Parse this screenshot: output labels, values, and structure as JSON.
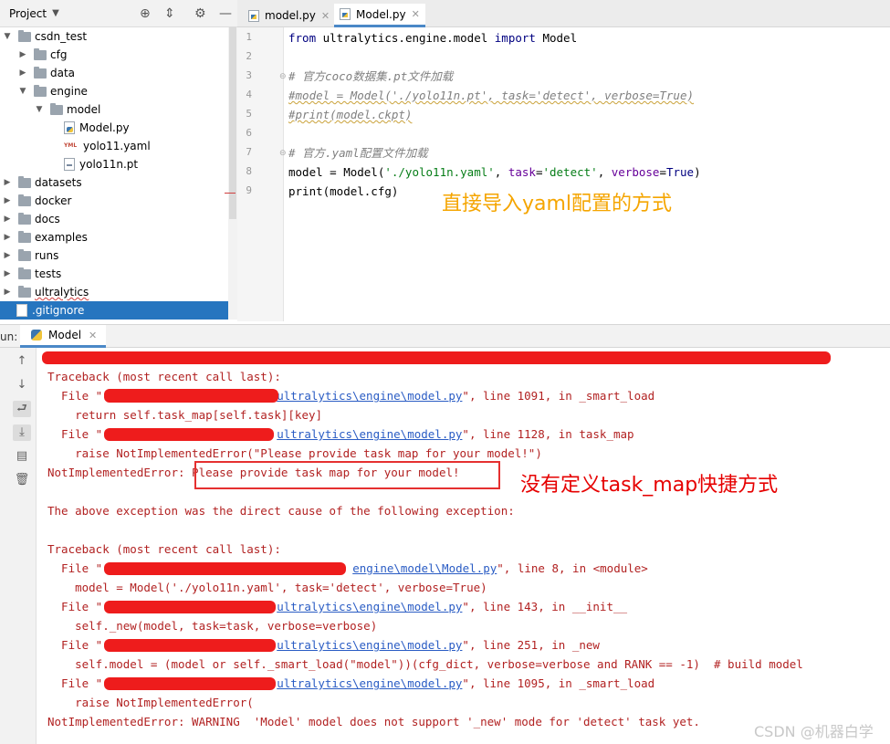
{
  "project_panel": {
    "title": "Project",
    "tree": [
      {
        "label": "csdn_test",
        "type": "folder",
        "depth": 0,
        "expanded": true
      },
      {
        "label": "cfg",
        "type": "folder",
        "depth": 1,
        "expanded": false
      },
      {
        "label": "data",
        "type": "folder",
        "depth": 1,
        "expanded": false
      },
      {
        "label": "engine",
        "type": "folder",
        "depth": 1,
        "expanded": true
      },
      {
        "label": "model",
        "type": "folder",
        "depth": 2,
        "expanded": true
      },
      {
        "label": "Model.py",
        "type": "py",
        "depth": 3
      },
      {
        "label": "yolo11.yaml",
        "type": "yaml",
        "depth": 3
      },
      {
        "label": "yolo11n.pt",
        "type": "pt",
        "depth": 3
      },
      {
        "label": "datasets",
        "type": "folder",
        "depth": 0,
        "expanded": false
      },
      {
        "label": "docker",
        "type": "folder",
        "depth": 0,
        "expanded": false
      },
      {
        "label": "docs",
        "type": "folder",
        "depth": 0,
        "expanded": false
      },
      {
        "label": "examples",
        "type": "folder",
        "depth": 0,
        "expanded": false
      },
      {
        "label": "runs",
        "type": "folder",
        "depth": 0,
        "expanded": false
      },
      {
        "label": "tests",
        "type": "folder",
        "depth": 0,
        "expanded": false
      },
      {
        "label": "ultralytics",
        "type": "folder",
        "depth": 0,
        "expanded": false
      },
      {
        "label": ".gitignore",
        "type": "git",
        "depth": 0,
        "selected": true
      }
    ]
  },
  "editor": {
    "tabs": [
      {
        "label": "model.py",
        "active": false
      },
      {
        "label": "Model.py",
        "active": true
      }
    ],
    "line_numbers": [
      "1",
      "2",
      "3",
      "4",
      "5",
      "6",
      "7",
      "8",
      "9"
    ],
    "code": {
      "l1_kw1": "from",
      "l1_mod": " ultralytics.engine.model ",
      "l1_kw2": "import",
      "l1_name": " Model",
      "l3": "# 官方coco数据集.pt文件加载",
      "l4": "#model = Model('./yolo11n.pt', task='detect', verbose=True)",
      "l5": "#print(model.ckpt)",
      "l7": "# 官方.yaml配置文件加载",
      "l8_a": "model = Model(",
      "l8_s1": "'./yolo11n.yaml'",
      "l8_b": ", ",
      "l8_k1": "task",
      "l8_c": "=",
      "l8_s2": "'detect'",
      "l8_d": ", ",
      "l8_k2": "verbose",
      "l8_e": "=",
      "l8_v": "True",
      "l8_f": ")",
      "l9": "print(model.cfg)"
    },
    "annotation": "直接导入yaml配置的方式"
  },
  "run_panel": {
    "label": "un:",
    "tab": "Model",
    "console": {
      "l2": "Traceback (most recent call last):",
      "l3_a": "  File \"",
      "l3_link": "ultralytics\\engine\\model.py",
      "l3_b": "\", line 1091, in _smart_load",
      "l4": "    return self.task_map[self.task][key]",
      "l5_a": "  File \"",
      "l5_link": "ultralytics\\engine\\model.py",
      "l5_b": "\", line 1128, in task_map",
      "l6": "    raise NotImplementedError(\"Please provide task map for your model!\")",
      "l7": "NotImplementedError: Please provide task map for your model!",
      "l9": "The above exception was the direct cause of the following exception:",
      "l11": "Traceback (most recent call last):",
      "l12_a": "  File \"",
      "l12_link": "engine\\model\\Model.py",
      "l12_b": "\", line 8, in <module>",
      "l13": "    model = Model('./yolo11n.yaml', task='detect', verbose=True)",
      "l14_a": "  File \"",
      "l14_link": "ultralytics\\engine\\model.py",
      "l14_b": "\", line 143, in __init__",
      "l15": "    self._new(model, task=task, verbose=verbose)",
      "l16_a": "  File \"",
      "l16_link": "ultralytics\\engine\\model.py",
      "l16_b": "\", line 251, in _new",
      "l17": "    self.model = (model or self._smart_load(\"model\"))(cfg_dict, verbose=verbose and RANK == -1)  # build model",
      "l18_a": "  File \"",
      "l18_link": "ultralytics\\engine\\model.py",
      "l18_b": "\", line 1095, in _smart_load",
      "l19": "    raise NotImplementedError(",
      "l20": "NotImplementedError: WARNING  'Model' model does not support '_new' mode for 'detect' task yet."
    },
    "annotation": "没有定义task_map快捷方式"
  },
  "watermark": "CSDN @机器白学",
  "colors": {
    "selection": "#2675bf",
    "error_text": "#b22222",
    "link": "#2a5cc4",
    "redaction": "#ee1c1c",
    "annotation_yellow": "#f5a500",
    "annotation_red": "#e60000"
  },
  "icons": [
    "target-icon",
    "collapse-icon",
    "gear-icon",
    "minimize-icon",
    "arrow-up-icon",
    "arrow-down-icon",
    "soft-wrap-icon",
    "scroll-to-end-icon",
    "print-icon",
    "trash-icon"
  ]
}
